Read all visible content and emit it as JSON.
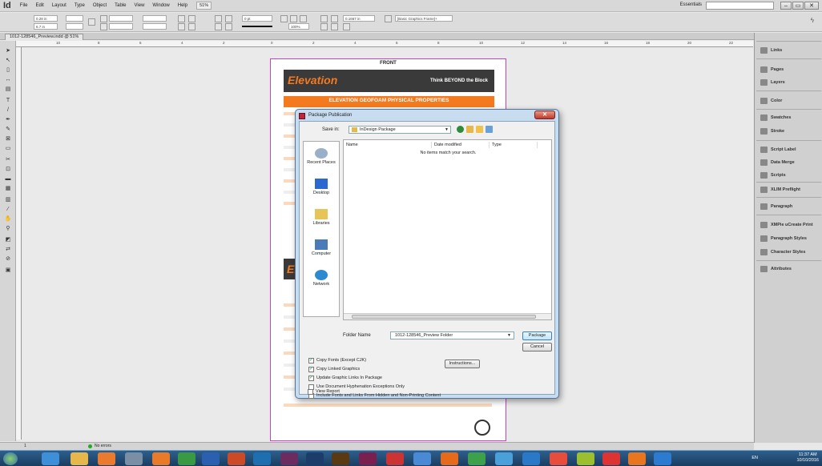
{
  "app": {
    "logo": "Id",
    "menu": [
      "File",
      "Edit",
      "Layout",
      "Type",
      "Object",
      "Table",
      "View",
      "Window",
      "Help"
    ],
    "zoom": "51%",
    "workspace": "Essentials",
    "window_buttons": [
      "–",
      "▭",
      "✕"
    ]
  },
  "control": {
    "x": "0.28 in",
    "y": "6.7 in",
    "stroke": "0 pt",
    "percent": "100%",
    "value": "0.1667 in",
    "style": "[Basic Graphics Frame]+"
  },
  "document": {
    "tab": "1012-128546_Preview.indd @ 51%",
    "page_label": "FRONT",
    "brand": "Elevation",
    "tagline": "Think BEYOND the Block",
    "heading": "ELEVATION GEOFOAM PHYSICAL PROPERTIES"
  },
  "ruler_ticks": [
    "10",
    "8",
    "6",
    "4",
    "2",
    "0",
    "2",
    "4",
    "6",
    "8",
    "10",
    "12",
    "14",
    "16",
    "18",
    "20",
    "22"
  ],
  "panels": [
    "Links",
    "Pages",
    "Layers",
    "Color",
    "Swatches",
    "Stroke",
    "Script Label",
    "Data Merge",
    "Scripts",
    "XLIM Preflight",
    "Paragraph",
    "XMPie uCreate Print",
    "Paragraph Styles",
    "Character Styles",
    "Attributes"
  ],
  "dialog": {
    "title": "Package Publication",
    "save_in_label": "Save in:",
    "save_in_value": "InDesign Package",
    "places": [
      "Recent Places",
      "Desktop",
      "Libraries",
      "Computer",
      "Network"
    ],
    "columns": [
      "Name",
      "Date modified",
      "Type"
    ],
    "empty_message": "No items match your search.",
    "folder_name_label": "Folder Name",
    "folder_name_value": "1012-128546_Preview Folder",
    "package_button": "Package",
    "cancel_button": "Cancel",
    "instructions_button": "Instructions...",
    "options": [
      {
        "label": "Copy Fonts (Except CJK)",
        "checked": true
      },
      {
        "label": "Copy Linked Graphics",
        "checked": true
      },
      {
        "label": "Update Graphic Links In Package",
        "checked": true
      },
      {
        "label": "Use Document Hyphenation Exceptions Only",
        "checked": false
      },
      {
        "label": "Include Fonts and Links From Hidden and Non-Printing Content",
        "checked": false
      },
      {
        "label": "View Report",
        "checked": false
      }
    ],
    "close": "✕"
  },
  "status": {
    "page": "1",
    "errors": "No errors"
  },
  "taskbar": {
    "lang": "EN",
    "time": "11:37 AM",
    "date": "10/10/2016"
  }
}
